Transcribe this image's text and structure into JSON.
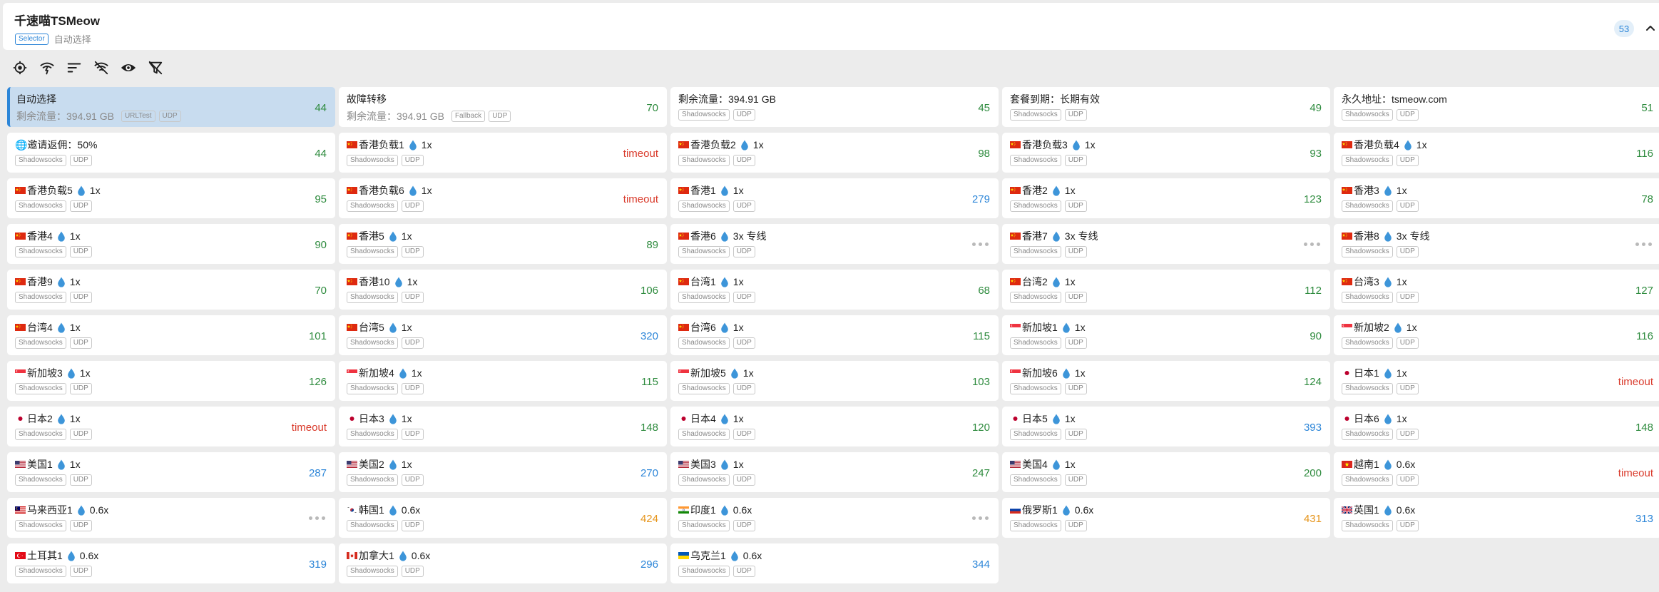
{
  "group": {
    "title": "千速喵TSMeow",
    "type_badge": "Selector",
    "current": "自动选择",
    "count": "53"
  },
  "toolbar": {
    "icons": [
      "locate-icon",
      "wifi-test-icon",
      "sort-icon",
      "hide-unavailable-icon",
      "eye-icon",
      "filter-off-icon"
    ]
  },
  "colors": {
    "accent": "#2d86d8",
    "delay_good": "#2e8b3e",
    "delay_medium": "#2d86d8",
    "delay_slow": "#e6951c",
    "timeout": "#d93a2b",
    "selected_bg": "#c8dcef"
  },
  "proxies": [
    {
      "name": "自动选择",
      "sub": "剩余流量：394.91 GB",
      "tags": [
        "URLTest",
        "UDP"
      ],
      "delay": "44",
      "level": "green",
      "selected": true
    },
    {
      "name": "故障转移",
      "sub": "剩余流量：394.91 GB",
      "tags": [
        "Fallback",
        "UDP"
      ],
      "delay": "70",
      "level": "green"
    },
    {
      "name": "剩余流量：394.91 GB",
      "tags": [
        "Shadowsocks",
        "UDP"
      ],
      "delay": "45",
      "level": "green"
    },
    {
      "name": "套餐到期：长期有效",
      "tags": [
        "Shadowsocks",
        "UDP"
      ],
      "delay": "49",
      "level": "green"
    },
    {
      "name": "永久地址：tsmeow.com",
      "tags": [
        "Shadowsocks",
        "UDP"
      ],
      "delay": "51",
      "level": "green"
    },
    {
      "name": "🌐邀请返佣：50%",
      "tags": [
        "Shadowsocks",
        "UDP"
      ],
      "delay": "44",
      "level": "green"
    },
    {
      "flag": "cn",
      "name": "香港负载1",
      "mult": "1x",
      "tags": [
        "Shadowsocks",
        "UDP"
      ],
      "delay": "timeout",
      "level": "red"
    },
    {
      "flag": "cn",
      "name": "香港负载2",
      "mult": "1x",
      "tags": [
        "Shadowsocks",
        "UDP"
      ],
      "delay": "98",
      "level": "green"
    },
    {
      "flag": "cn",
      "name": "香港负载3",
      "mult": "1x",
      "tags": [
        "Shadowsocks",
        "UDP"
      ],
      "delay": "93",
      "level": "green"
    },
    {
      "flag": "cn",
      "name": "香港负载4",
      "mult": "1x",
      "tags": [
        "Shadowsocks",
        "UDP"
      ],
      "delay": "116",
      "level": "green"
    },
    {
      "flag": "cn",
      "name": "香港负载5",
      "mult": "1x",
      "tags": [
        "Shadowsocks",
        "UDP"
      ],
      "delay": "95",
      "level": "green"
    },
    {
      "flag": "cn",
      "name": "香港负载6",
      "mult": "1x",
      "tags": [
        "Shadowsocks",
        "UDP"
      ],
      "delay": "timeout",
      "level": "red"
    },
    {
      "flag": "cn",
      "name": "香港1",
      "mult": "1x",
      "tags": [
        "Shadowsocks",
        "UDP"
      ],
      "delay": "279",
      "level": "blue"
    },
    {
      "flag": "cn",
      "name": "香港2",
      "mult": "1x",
      "tags": [
        "Shadowsocks",
        "UDP"
      ],
      "delay": "123",
      "level": "green"
    },
    {
      "flag": "cn",
      "name": "香港3",
      "mult": "1x",
      "tags": [
        "Shadowsocks",
        "UDP"
      ],
      "delay": "78",
      "level": "green"
    },
    {
      "flag": "cn",
      "name": "香港4",
      "mult": "1x",
      "tags": [
        "Shadowsocks",
        "UDP"
      ],
      "delay": "90",
      "level": "green"
    },
    {
      "flag": "cn",
      "name": "香港5",
      "mult": "1x",
      "tags": [
        "Shadowsocks",
        "UDP"
      ],
      "delay": "89",
      "level": "green"
    },
    {
      "flag": "cn",
      "name": "香港6",
      "mult": "3x 专线",
      "tags": [
        "Shadowsocks",
        "UDP"
      ],
      "delay": "",
      "level": "untested"
    },
    {
      "flag": "cn",
      "name": "香港7",
      "mult": "3x 专线",
      "tags": [
        "Shadowsocks",
        "UDP"
      ],
      "delay": "",
      "level": "untested"
    },
    {
      "flag": "cn",
      "name": "香港8",
      "mult": "3x 专线",
      "tags": [
        "Shadowsocks",
        "UDP"
      ],
      "delay": "",
      "level": "untested"
    },
    {
      "flag": "cn",
      "name": "香港9",
      "mult": "1x",
      "tags": [
        "Shadowsocks",
        "UDP"
      ],
      "delay": "70",
      "level": "green"
    },
    {
      "flag": "cn",
      "name": "香港10",
      "mult": "1x",
      "tags": [
        "Shadowsocks",
        "UDP"
      ],
      "delay": "106",
      "level": "green"
    },
    {
      "flag": "cn",
      "name": "台湾1",
      "mult": "1x",
      "tags": [
        "Shadowsocks",
        "UDP"
      ],
      "delay": "68",
      "level": "green"
    },
    {
      "flag": "cn",
      "name": "台湾2",
      "mult": "1x",
      "tags": [
        "Shadowsocks",
        "UDP"
      ],
      "delay": "112",
      "level": "green"
    },
    {
      "flag": "cn",
      "name": "台湾3",
      "mult": "1x",
      "tags": [
        "Shadowsocks",
        "UDP"
      ],
      "delay": "127",
      "level": "green"
    },
    {
      "flag": "cn",
      "name": "台湾4",
      "mult": "1x",
      "tags": [
        "Shadowsocks",
        "UDP"
      ],
      "delay": "101",
      "level": "green"
    },
    {
      "flag": "cn",
      "name": "台湾5",
      "mult": "1x",
      "tags": [
        "Shadowsocks",
        "UDP"
      ],
      "delay": "320",
      "level": "blue"
    },
    {
      "flag": "cn",
      "name": "台湾6",
      "mult": "1x",
      "tags": [
        "Shadowsocks",
        "UDP"
      ],
      "delay": "115",
      "level": "green"
    },
    {
      "flag": "sg",
      "name": "新加坡1",
      "mult": "1x",
      "tags": [
        "Shadowsocks",
        "UDP"
      ],
      "delay": "90",
      "level": "green"
    },
    {
      "flag": "sg",
      "name": "新加坡2",
      "mult": "1x",
      "tags": [
        "Shadowsocks",
        "UDP"
      ],
      "delay": "116",
      "level": "green"
    },
    {
      "flag": "sg",
      "name": "新加坡3",
      "mult": "1x",
      "tags": [
        "Shadowsocks",
        "UDP"
      ],
      "delay": "126",
      "level": "green"
    },
    {
      "flag": "sg",
      "name": "新加坡4",
      "mult": "1x",
      "tags": [
        "Shadowsocks",
        "UDP"
      ],
      "delay": "115",
      "level": "green"
    },
    {
      "flag": "sg",
      "name": "新加坡5",
      "mult": "1x",
      "tags": [
        "Shadowsocks",
        "UDP"
      ],
      "delay": "103",
      "level": "green"
    },
    {
      "flag": "sg",
      "name": "新加坡6",
      "mult": "1x",
      "tags": [
        "Shadowsocks",
        "UDP"
      ],
      "delay": "124",
      "level": "green"
    },
    {
      "flag": "jp",
      "name": "日本1",
      "mult": "1x",
      "tags": [
        "Shadowsocks",
        "UDP"
      ],
      "delay": "timeout",
      "level": "red"
    },
    {
      "flag": "jp",
      "name": "日本2",
      "mult": "1x",
      "tags": [
        "Shadowsocks",
        "UDP"
      ],
      "delay": "timeout",
      "level": "red"
    },
    {
      "flag": "jp",
      "name": "日本3",
      "mult": "1x",
      "tags": [
        "Shadowsocks",
        "UDP"
      ],
      "delay": "148",
      "level": "green"
    },
    {
      "flag": "jp",
      "name": "日本4",
      "mult": "1x",
      "tags": [
        "Shadowsocks",
        "UDP"
      ],
      "delay": "120",
      "level": "green"
    },
    {
      "flag": "jp",
      "name": "日本5",
      "mult": "1x",
      "tags": [
        "Shadowsocks",
        "UDP"
      ],
      "delay": "393",
      "level": "blue"
    },
    {
      "flag": "jp",
      "name": "日本6",
      "mult": "1x",
      "tags": [
        "Shadowsocks",
        "UDP"
      ],
      "delay": "148",
      "level": "green"
    },
    {
      "flag": "us",
      "name": "美国1",
      "mult": "1x",
      "tags": [
        "Shadowsocks",
        "UDP"
      ],
      "delay": "287",
      "level": "blue"
    },
    {
      "flag": "us",
      "name": "美国2",
      "mult": "1x",
      "tags": [
        "Shadowsocks",
        "UDP"
      ],
      "delay": "270",
      "level": "blue"
    },
    {
      "flag": "us",
      "name": "美国3",
      "mult": "1x",
      "tags": [
        "Shadowsocks",
        "UDP"
      ],
      "delay": "247",
      "level": "green"
    },
    {
      "flag": "us",
      "name": "美国4",
      "mult": "1x",
      "tags": [
        "Shadowsocks",
        "UDP"
      ],
      "delay": "200",
      "level": "green"
    },
    {
      "flag": "vn",
      "name": "越南1",
      "mult": "0.6x",
      "tags": [
        "Shadowsocks",
        "UDP"
      ],
      "delay": "timeout",
      "level": "red"
    },
    {
      "flag": "my",
      "name": "马来西亚1",
      "mult": "0.6x",
      "tags": [
        "Shadowsocks",
        "UDP"
      ],
      "delay": "",
      "level": "untested"
    },
    {
      "flag": "kr",
      "name": "韩国1",
      "mult": "0.6x",
      "tags": [
        "Shadowsocks",
        "UDP"
      ],
      "delay": "424",
      "level": "orange"
    },
    {
      "flag": "in",
      "name": "印度1",
      "mult": "0.6x",
      "tags": [
        "Shadowsocks",
        "UDP"
      ],
      "delay": "",
      "level": "untested"
    },
    {
      "flag": "ru",
      "name": "俄罗斯1",
      "mult": "0.6x",
      "tags": [
        "Shadowsocks",
        "UDP"
      ],
      "delay": "431",
      "level": "orange"
    },
    {
      "flag": "gb",
      "name": "英国1",
      "mult": "0.6x",
      "tags": [
        "Shadowsocks",
        "UDP"
      ],
      "delay": "313",
      "level": "blue"
    },
    {
      "flag": "tr",
      "name": "土耳其1",
      "mult": "0.6x",
      "tags": [
        "Shadowsocks",
        "UDP"
      ],
      "delay": "319",
      "level": "blue"
    },
    {
      "flag": "ca",
      "name": "加拿大1",
      "mult": "0.6x",
      "tags": [
        "Shadowsocks",
        "UDP"
      ],
      "delay": "296",
      "level": "blue"
    },
    {
      "flag": "ua",
      "name": "乌克兰1",
      "mult": "0.6x",
      "tags": [
        "Shadowsocks",
        "UDP"
      ],
      "delay": "344",
      "level": "blue"
    }
  ]
}
